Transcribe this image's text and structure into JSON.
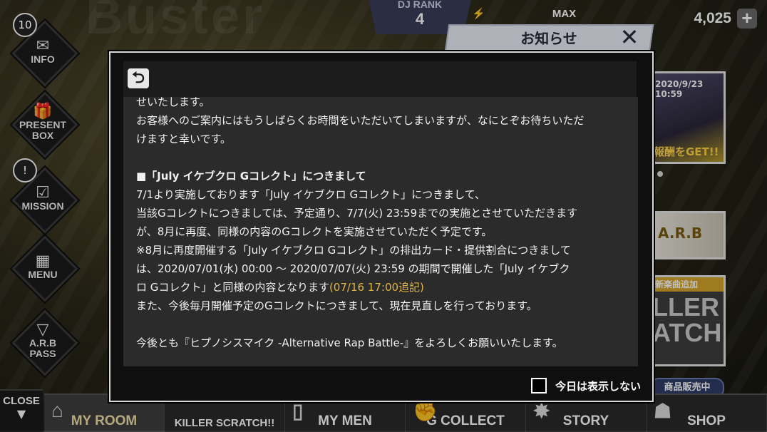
{
  "topbar": {
    "rank_label": "DJ RANK",
    "rank_value": "4",
    "stamina_max": "MAX",
    "coins": "4,025",
    "plus": "+"
  },
  "sidebar": {
    "info_count": "10",
    "items": [
      {
        "label": "INFO",
        "icon": "envelope-icon"
      },
      {
        "label": "PRESENT\nBOX",
        "icon": "gift-icon"
      },
      {
        "label": "MISSION",
        "icon": "checklist-icon"
      },
      {
        "label": "MENU",
        "icon": "grid-icon"
      },
      {
        "label": "A.R.B\nPASS",
        "icon": "pass-icon"
      }
    ],
    "mission_alert": "!",
    "close_label": "CLOSE"
  },
  "notice_panel": {
    "title": "お知らせ",
    "close": "✕"
  },
  "banners": {
    "b1_date": "2020/9/23 10:59",
    "b1_text": "報酬をGET!!",
    "b2_text": "A.R.B",
    "b3_tag": "新楽曲追加",
    "b3_text": "LLER\nATCH!!",
    "sale": "商品販売中"
  },
  "bottom_nav": [
    {
      "label": "MY ROOM",
      "active": true
    },
    {
      "label": "KILLER SCRATCH!!",
      "active": false
    },
    {
      "label": "MY MEN",
      "active": false
    },
    {
      "label": "G COLLECT",
      "active": false
    },
    {
      "label": "STORY",
      "active": false
    },
    {
      "label": "SHOP",
      "active": false
    }
  ],
  "modal": {
    "back_icon": "⮌",
    "lines": [
      "せいたします。",
      "お客様へのご案内にはもうしばらくお時間をいただいてしまいますが、なにとぞお待ちいただ",
      "けますと幸いです。",
      "",
      "■「July イケブクロ Gコレクト」につきまして",
      "7/1より実施しております「July イケブクロ Gコレクト」につきまして、",
      "当該Gコレクトにつきましては、予定通り、7/7(火) 23:59までの実施とさせていただきます",
      "が、8月に再度、同様の内容のGコレクトを実施させていただく予定です。",
      "※8月に再度開催する「July イケブクロ Gコレクト」の排出カード・提供割合につきまして",
      "は、2020/07/01(水) 00:00 〜 2020/07/07(火) 23:59 の期間で開催した「July イケブク",
      "ロ Gコレクト」と同様の内容となります",
      "また、今後毎月開催予定のGコレクトにつきまして、現在見直しを行っております。",
      "",
      "今後とも『ヒプノシスマイク -Alternative Rap Battle-』をよろしくお願いいたします。"
    ],
    "note": "(07/16 17:00追記)",
    "dont_show_label": "今日は表示しない"
  }
}
